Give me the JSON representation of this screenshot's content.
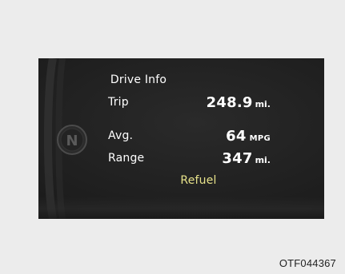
{
  "colors": {
    "page_background": "#ececec",
    "panel_background": "#1c1c1c",
    "text_primary": "#ffffff",
    "refuel_accent": "#e7e28a",
    "caption_text": "#222222"
  },
  "cluster": {
    "title": "Drive Info",
    "rows": [
      {
        "label": "Trip",
        "value": "248.9",
        "unit": "mi."
      },
      {
        "label": "Avg.",
        "value": "64",
        "unit": "MPG"
      },
      {
        "label": "Range",
        "value": "347",
        "unit": "mi."
      }
    ],
    "warning": "Refuel",
    "gear_letter": "N",
    "icons": {
      "gear_indicator": "gear-n-indicator-icon"
    }
  },
  "caption": "OTF044367"
}
